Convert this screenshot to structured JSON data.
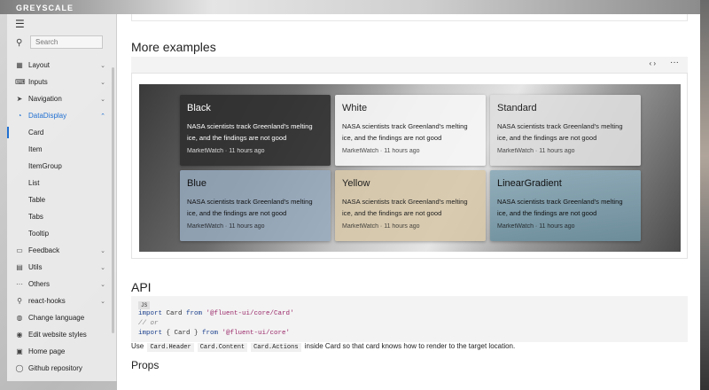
{
  "brand": "GREYSCALE",
  "sidebar": {
    "search_placeholder": "Search",
    "items": [
      {
        "label": "Layout",
        "icon": "layout-icon"
      },
      {
        "label": "Inputs",
        "icon": "inputs-icon"
      },
      {
        "label": "Navigation",
        "icon": "navigation-icon"
      },
      {
        "label": "DataDisplay",
        "icon": "datadisplay-icon"
      }
    ],
    "sub_items": [
      "Card",
      "Item",
      "ItemGroup",
      "List",
      "Table",
      "Tabs",
      "Tooltip"
    ],
    "items_after": [
      {
        "label": "Feedback",
        "icon": "feedback-icon"
      },
      {
        "label": "Utils",
        "icon": "utils-icon"
      },
      {
        "label": "Others",
        "icon": "others-icon"
      },
      {
        "label": "react-hooks",
        "icon": "react-hooks-icon"
      }
    ],
    "links": [
      {
        "label": "Change language",
        "icon": "globe-icon"
      },
      {
        "label": "Edit website styles",
        "icon": "palette-icon"
      },
      {
        "label": "Home page",
        "icon": "home-icon"
      },
      {
        "label": "Github repository",
        "icon": "github-icon"
      }
    ],
    "accent": "#1f6fd1"
  },
  "main": {
    "more_examples_title": "More examples",
    "toolbar": {
      "code_label": "‹ ›",
      "more_label": "···"
    },
    "cards": [
      {
        "title": "Black",
        "body": "NASA scientists track Greenland's melting ice, and the findings are not good",
        "meta": "MarketWatch · 11 hours ago"
      },
      {
        "title": "White",
        "body": "NASA scientists track Greenland's melting ice, and the findings are not good",
        "meta": "MarketWatch · 11 hours ago"
      },
      {
        "title": "Standard",
        "body": "NASA scientists track Greenland's melting ice, and the findings are not good",
        "meta": "MarketWatch · 11 hours ago"
      },
      {
        "title": "Blue",
        "body": "NASA scientists track Greenland's melting ice, and the findings are not good",
        "meta": "MarketWatch · 11 hours ago"
      },
      {
        "title": "Yellow",
        "body": "NASA scientists track Greenland's melting ice, and the findings are not good",
        "meta": "MarketWatch · 11 hours ago"
      },
      {
        "title": "LinearGradient",
        "body": "NASA scientists track Greenland's melting ice, and the findings are not good",
        "meta": "MarketWatch · 11 hours ago"
      }
    ],
    "api_title": "API",
    "code": {
      "lang": "JS",
      "line1_kw": "import",
      "line1_name": " Card ",
      "line1_from": "from",
      "line1_str": " '@fluent-ui/core/Card'",
      "line2": "// or",
      "line3_kw": "import",
      "line3_name": " { Card } ",
      "line3_from": "from",
      "line3_str": " '@fluent-ui/core'"
    },
    "use": {
      "prefix": "Use",
      "c1": "Card.Header",
      "c2": "Card.Content",
      "c3": "Card.Actions",
      "suffix": "inside Card so that card knows how to render to the target location."
    },
    "props_title": "Props"
  }
}
